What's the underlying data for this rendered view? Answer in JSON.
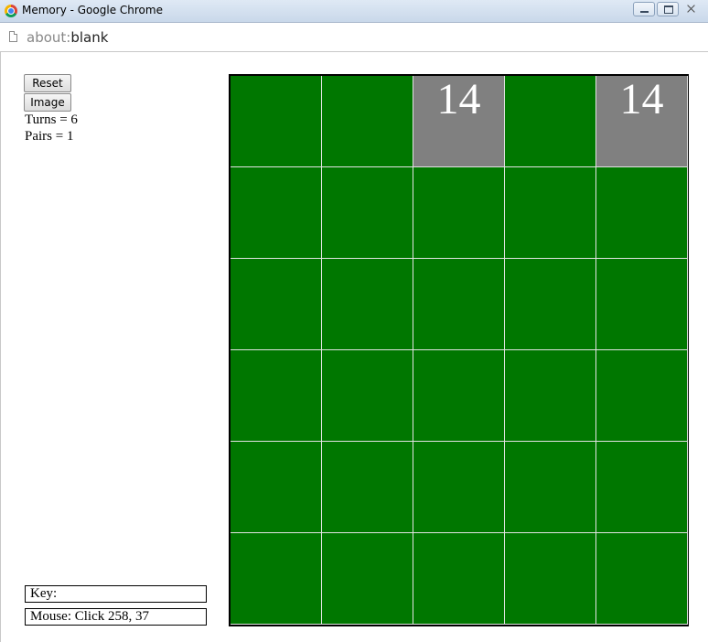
{
  "window": {
    "title": "Memory - Google Chrome"
  },
  "address": {
    "scheme": "about:",
    "rest": "blank"
  },
  "controls": {
    "reset_label": "Reset",
    "image_label": "Image"
  },
  "stats": {
    "turns": "Turns = 6",
    "pairs": "Pairs = 1"
  },
  "status": {
    "key": "Key:",
    "mouse": "Mouse: Click 258, 37"
  },
  "board": {
    "columns": 5,
    "rows": 6,
    "colors": {
      "hidden": "#007700",
      "revealed": "#808080",
      "grid_line": "#e4e4e4",
      "number": "#ffffff"
    },
    "cells": [
      "",
      "",
      "14",
      "",
      "14",
      "",
      "",
      "",
      "",
      "",
      "",
      "",
      "",
      "",
      "",
      "",
      "",
      "",
      "",
      "",
      "",
      "",
      "",
      "",
      "",
      "",
      "",
      "",
      "",
      ""
    ]
  }
}
